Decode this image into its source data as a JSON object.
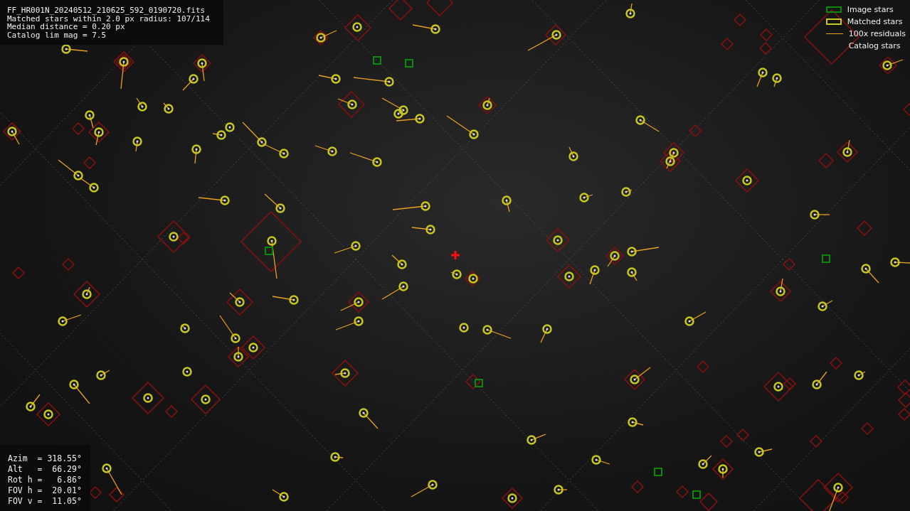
{
  "info_panel": {
    "lines": [
      "FF_HR001N_20240512_210625_592_0190720.fits",
      "Matched stars within 2.0 px radius: 107/114",
      "Median distance = 0.20 px",
      "Catalog lim mag = 7.5"
    ]
  },
  "pointing_panel": {
    "lines": [
      "Azim  = 318.55°",
      "Alt   =  66.29°",
      "Rot h =   6.86°",
      "FOV h =  20.01°",
      "FOV v =  11.05°"
    ]
  },
  "legend": [
    {
      "kind": "image",
      "label": "Image stars",
      "color": "#0a8a0a"
    },
    {
      "kind": "matched",
      "label": "Matched stars",
      "color": "#c8c81e"
    },
    {
      "kind": "residual",
      "label": "100x residuals",
      "color": "#e8a020"
    },
    {
      "kind": "catalog",
      "label": "Catalog stars"
    }
  ]
}
